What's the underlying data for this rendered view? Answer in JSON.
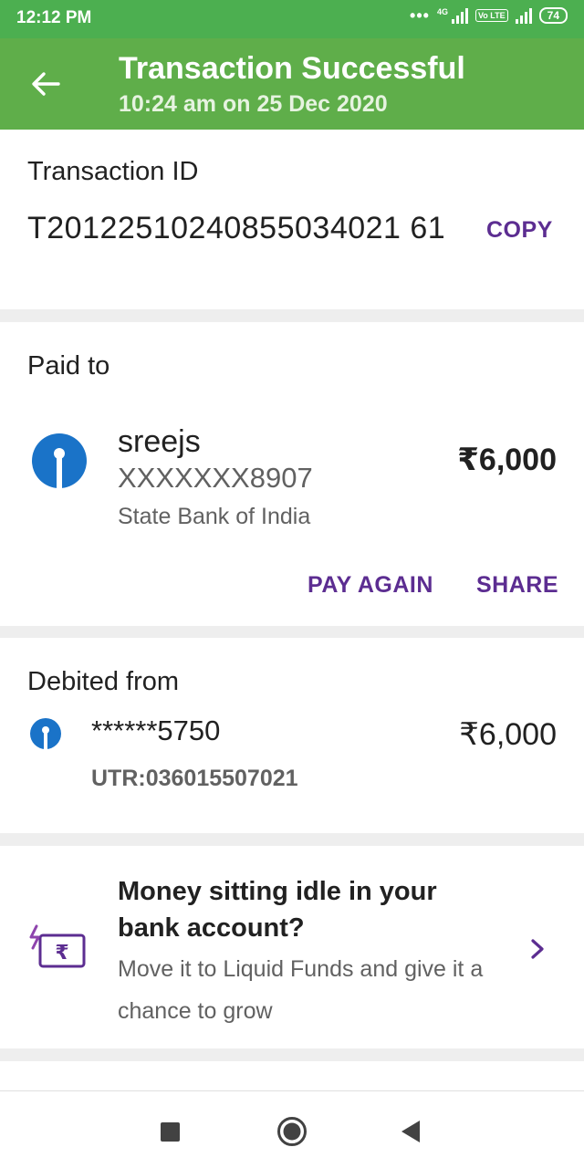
{
  "status_bar": {
    "time": "12:12 PM",
    "network_label": "4G",
    "volte_label": "Vo LTE",
    "battery": "74",
    "icons": [
      "dots-icon",
      "signal-icon",
      "volte-icon",
      "signal-icon",
      "battery-icon"
    ]
  },
  "app_bar": {
    "back_icon": "arrow-left-icon",
    "title": "Transaction Successful",
    "subtitle": "10:24 am on 25 Dec 2020"
  },
  "transaction": {
    "heading": "Transaction ID",
    "id": "T20122510240855034021 61",
    "copy_label": "COPY"
  },
  "paid_to": {
    "heading": "Paid to",
    "logo_icon": "sbi-logo-icon",
    "name": "sreejs",
    "account": "XXXXXXX8907",
    "bank": "State Bank of India",
    "amount": "₹6,000",
    "pay_again_label": "PAY AGAIN",
    "share_label": "SHARE"
  },
  "debited_from": {
    "heading": "Debited from",
    "logo_icon": "sbi-logo-icon",
    "account": "******5750",
    "amount": "₹6,000",
    "utr": "UTR:036015507021"
  },
  "promo": {
    "icon": "rupee-card-icon",
    "title": "Money sitting idle in your bank account?",
    "body": "Move it to Liquid Funds and give it a chance to grow",
    "chevron_icon": "chevron-right-icon"
  },
  "nav_bar": {
    "icons": [
      "recents-square-icon",
      "home-circle-icon",
      "back-triangle-icon"
    ]
  },
  "colors": {
    "header_green": "#5fae4a",
    "status_green": "#4caf50",
    "accent_purple": "#5c2d91",
    "sbi_blue": "#1a73c8"
  }
}
